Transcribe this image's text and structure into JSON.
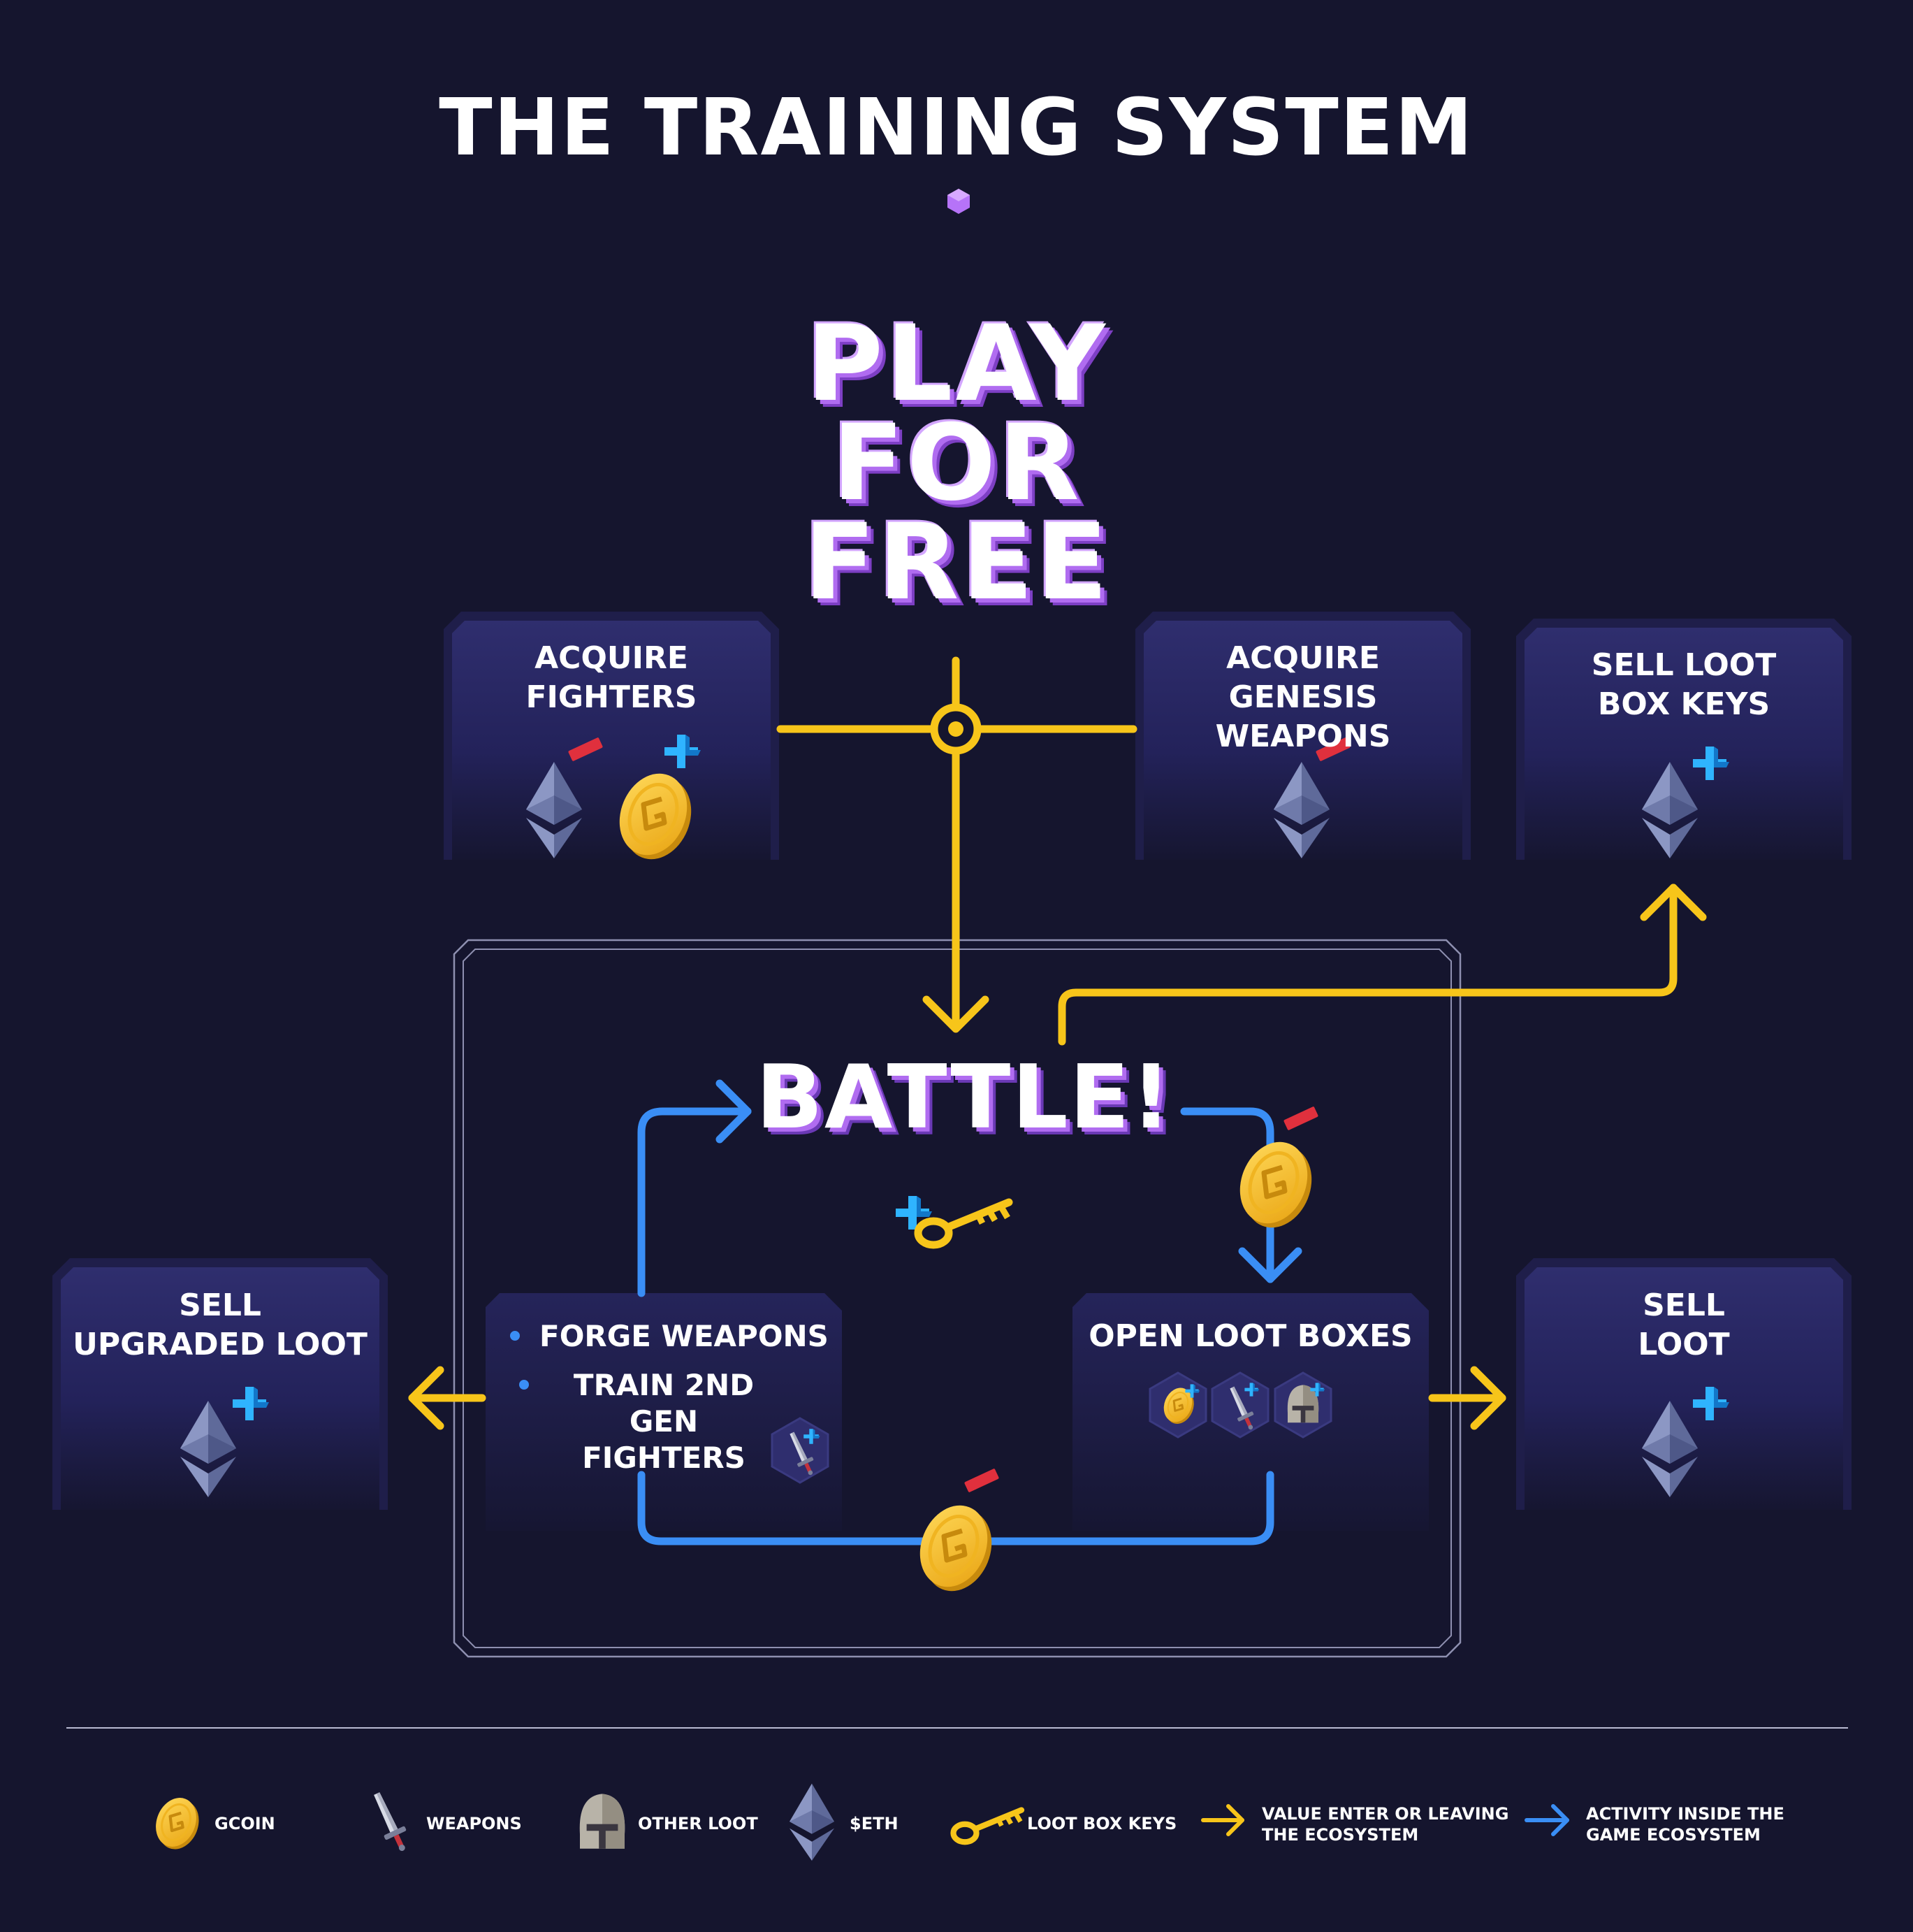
{
  "title": "THE TRAINING SYSTEM",
  "play_for_free": "PLAY\nFOR\nFREE",
  "battle": "BATTLE!",
  "boxes": {
    "acquire_fighters": "ACQUIRE\nFIGHTERS",
    "acquire_genesis": "ACQUIRE\nGENESIS WEAPONS",
    "sell_keys": "SELL LOOT\nBOX KEYS",
    "sell_upgraded": "SELL\nUPGRADED LOOT",
    "sell_loot": "SELL\nLOOT",
    "open_loot": "OPEN LOOT BOXES"
  },
  "forge_items": [
    "FORGE WEAPONS",
    "TRAIN 2ND GEN\nFIGHTERS"
  ],
  "legend": [
    {
      "icon": "gcoin-icon",
      "label": "GCOIN"
    },
    {
      "icon": "sword-icon",
      "label": "WEAPONS"
    },
    {
      "icon": "helmet-icon",
      "label": "OTHER LOOT"
    },
    {
      "icon": "eth-icon",
      "label": "$ETH"
    },
    {
      "icon": "key-icon",
      "label": "LOOT BOX KEYS"
    },
    {
      "icon": "yellow-arrow-icon",
      "label": "VALUE ENTER OR LEAVING\nTHE ECOSYSTEM"
    },
    {
      "icon": "blue-arrow-icon",
      "label": "ACTIVITY INSIDE THE\nGAME ECOSYSTEM"
    }
  ],
  "colors": {
    "background": "#15152e",
    "value_flow": "#f7c51a",
    "activity_flow": "#3a8ef5",
    "accent_purple": "#a855f7",
    "minus": "#e0303d",
    "plus": "#2fb4ff"
  }
}
